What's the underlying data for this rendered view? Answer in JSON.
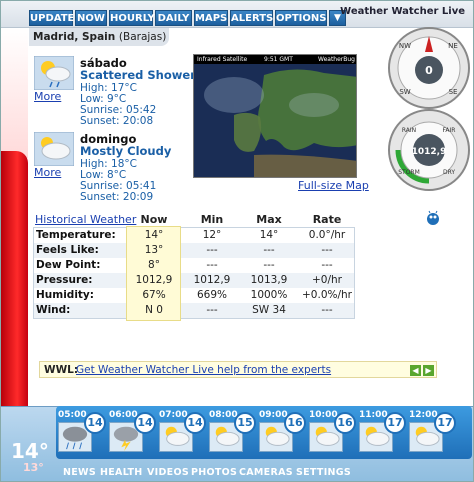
{
  "window": {
    "brand": "Weather Watcher Live"
  },
  "menu": [
    "UPDATE",
    "NOW",
    "HOURLY",
    "DAILY",
    "MAPS",
    "ALERTS",
    "OPTIONS"
  ],
  "location": {
    "city": "Madrid, Spain",
    "station": "(Barajas)"
  },
  "forecast": [
    {
      "day": "sábado",
      "condition": "Scattered Showers",
      "high": "High: 17°C",
      "low": "Low: 9°C",
      "sunrise": "Sunrise: 05:42",
      "sunset": "Sunset: 20:08",
      "more": "More",
      "icon": "partly-cloudy-rain-icon"
    },
    {
      "day": "domingo",
      "condition": "Mostly Cloudy",
      "high": "High: 18°C",
      "low": "Low: 8°C",
      "sunrise": "Sunrise: 05:41",
      "sunset": "Sunset: 20:09",
      "more": "More",
      "icon": "cloudy-icon"
    }
  ],
  "satellite": {
    "title": "Infrared Satellite",
    "time": "9:51 GMT",
    "source": "WeatherBug",
    "full_map": "Full-size Map"
  },
  "compass": {
    "value": "0",
    "dirs": [
      "NW",
      "NE",
      "SW",
      "SE"
    ]
  },
  "barometer": {
    "value": "1012,9",
    "labels": [
      "RAIN",
      "FAIR",
      "STORM",
      "DRY"
    ]
  },
  "table": {
    "historical_link": "Historical Weather",
    "headers": [
      "Now",
      "Min",
      "Max",
      "Rate"
    ],
    "rows": [
      {
        "label": "Temperature:",
        "now": "14°",
        "min": "12°",
        "max": "14°",
        "rate": "0.0°/hr"
      },
      {
        "label": "Feels Like:",
        "now": "13°",
        "min": "---",
        "max": "---",
        "rate": "---"
      },
      {
        "label": "Dew Point:",
        "now": "8°",
        "min": "---",
        "max": "---",
        "rate": "---"
      },
      {
        "label": "Pressure:",
        "now": "1012,9",
        "min": "1012,9",
        "max": "1013,9",
        "rate": "+0/hr"
      },
      {
        "label": "Humidity:",
        "now": "67%",
        "min": "669%",
        "max": "1000%",
        "rate": "+0.0%/hr"
      },
      {
        "label": "Wind:",
        "now": "N 0",
        "min": "---",
        "max": "SW 34",
        "rate": "---"
      }
    ]
  },
  "help": {
    "prefix": "WWL:",
    "link": "Get Weather Watcher Live help from the experts"
  },
  "current": {
    "temp": "14°",
    "feels": "13°"
  },
  "hourly": [
    {
      "time": "05:00",
      "temp": "14",
      "icon": "rain-cloud-icon"
    },
    {
      "time": "06:00",
      "temp": "14",
      "icon": "thunder-cloud-icon"
    },
    {
      "time": "07:00",
      "temp": "14",
      "icon": "partly-cloudy-icon"
    },
    {
      "time": "08:00",
      "temp": "15",
      "icon": "partly-cloudy-icon"
    },
    {
      "time": "09:00",
      "temp": "16",
      "icon": "partly-cloudy-icon"
    },
    {
      "time": "10:00",
      "temp": "16",
      "icon": "partly-cloudy-icon"
    },
    {
      "time": "11:00",
      "temp": "17",
      "icon": "partly-cloudy-icon"
    },
    {
      "time": "12:00",
      "temp": "17",
      "icon": "partly-cloudy-icon"
    }
  ],
  "bottom_nav": [
    "NEWS",
    "HEALTH",
    "VIDEOS",
    "PHOTOS",
    "CAMERAS",
    "SETTINGS"
  ]
}
